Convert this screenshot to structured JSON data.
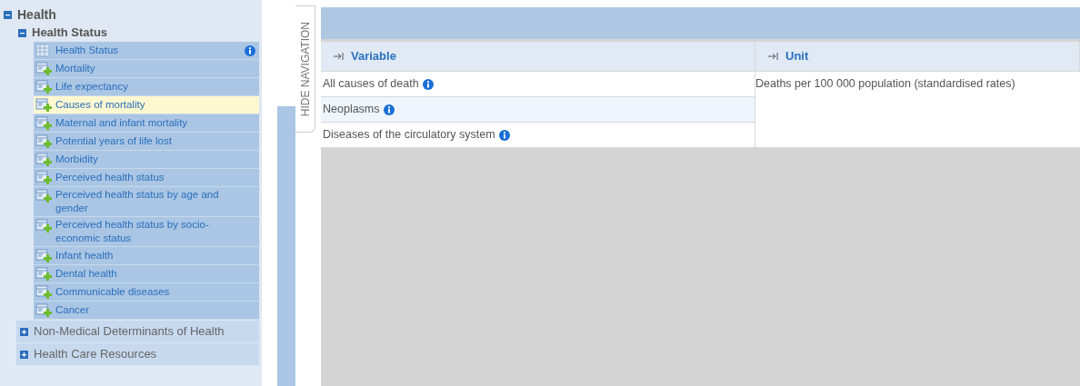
{
  "tree": [
    {
      "label": "Health",
      "expanded": true,
      "children": [
        {
          "label": "Health Status",
          "expanded": true,
          "children": [
            {
              "label": "Health Status",
              "kind": "table",
              "info": true,
              "selected": false
            },
            {
              "label": "Mortality",
              "kind": "query",
              "info": false,
              "selected": false
            },
            {
              "label": "Life expectancy",
              "kind": "query",
              "info": false,
              "selected": false
            },
            {
              "label": "Causes of mortality",
              "kind": "query",
              "info": false,
              "selected": true
            },
            {
              "label": "Maternal and infant mortality",
              "kind": "query",
              "info": false,
              "selected": false
            },
            {
              "label": "Potential years of life lost",
              "kind": "query",
              "info": false,
              "selected": false
            },
            {
              "label": "Morbidity",
              "kind": "query",
              "info": false,
              "selected": false
            },
            {
              "label": "Perceived health status",
              "kind": "query",
              "info": false,
              "selected": false
            },
            {
              "label": "Perceived health status by age and gender",
              "kind": "query",
              "info": false,
              "selected": false
            },
            {
              "label": "Perceived health status by socio-economic status",
              "kind": "query",
              "info": false,
              "selected": false
            },
            {
              "label": "Infant health",
              "kind": "query",
              "info": false,
              "selected": false
            },
            {
              "label": "Dental health",
              "kind": "query",
              "info": false,
              "selected": false
            },
            {
              "label": "Communicable diseases",
              "kind": "query",
              "info": false,
              "selected": false
            },
            {
              "label": "Cancer",
              "kind": "query",
              "info": false,
              "selected": false
            }
          ]
        },
        {
          "label": "Non-Medical Determinants of Health",
          "expanded": false
        },
        {
          "label": "Health Care Resources",
          "expanded": false
        }
      ]
    }
  ],
  "hide_navigation": "HIDE NAVIGATION",
  "table": {
    "columns": [
      "Variable",
      "Unit"
    ],
    "rows": [
      {
        "variable": "All causes of death",
        "highlighted": false
      },
      {
        "variable": "Neoplasms",
        "highlighted": true
      },
      {
        "variable": "Diseases of the circulatory system",
        "highlighted": false
      }
    ],
    "unit": "Deaths per 100 000 population (standardised rates)"
  }
}
